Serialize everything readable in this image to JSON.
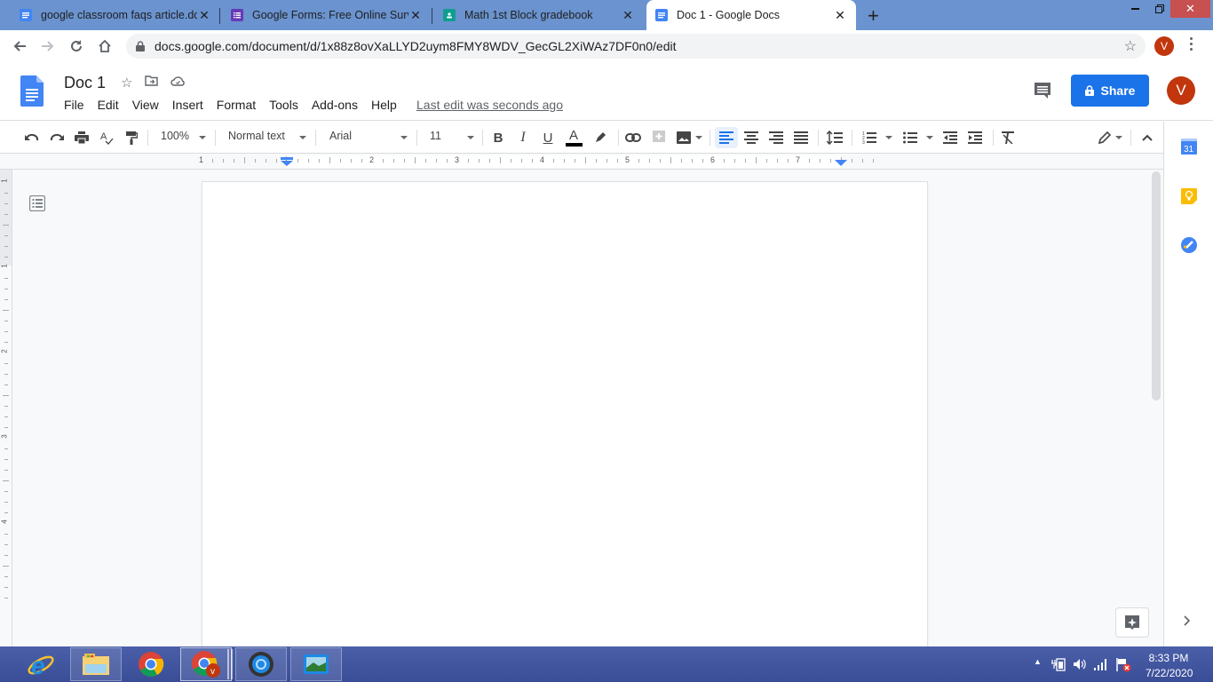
{
  "browser": {
    "tabs": [
      {
        "title": "google classroom faqs article.doc",
        "icon": "docs-icon",
        "color": "#4285f4",
        "active": false
      },
      {
        "title": "Google Forms: Free Online Survey",
        "icon": "forms-icon",
        "color": "#673ab7",
        "active": false
      },
      {
        "title": "Math 1st Block gradebook",
        "icon": "classroom-icon",
        "color": "#0f9d8f",
        "active": false
      },
      {
        "title": "Doc 1 - Google Docs",
        "icon": "docs-icon",
        "color": "#4285f4",
        "active": true
      }
    ],
    "new_tab_label": "+",
    "url": "docs.google.com/document/d/1x88z8ovXaLLYD2uym8FMY8WDV_GecGL2XiWAz7DF0n0/edit",
    "profile_initial": "V"
  },
  "docs": {
    "title": "Doc 1",
    "menu": [
      "File",
      "Edit",
      "View",
      "Insert",
      "Format",
      "Tools",
      "Add-ons",
      "Help"
    ],
    "last_edit": "Last edit was seconds ago",
    "share_label": "Share",
    "account_initial": "V",
    "toolbar": {
      "zoom": "100%",
      "style": "Normal text",
      "font": "Arial",
      "font_size": "11",
      "text_color": "#000000",
      "active_alignment": "left"
    },
    "ruler": {
      "labels": [
        "1",
        "1",
        "2",
        "3",
        "4",
        "5",
        "6",
        "7"
      ],
      "vertical_labels": [
        "1",
        "1",
        "2",
        "3",
        "4"
      ]
    },
    "accent_color": "#1a73e8"
  },
  "side_panel": [
    "calendar-icon",
    "keep-icon",
    "tasks-icon"
  ],
  "taskbar": {
    "apps": [
      "internet-explorer-icon",
      "file-explorer-icon",
      "chrome-icon",
      "chrome-profile-icon",
      "media-icon",
      "photos-icon"
    ],
    "time": "8:33 PM",
    "date": "7/22/2020"
  }
}
